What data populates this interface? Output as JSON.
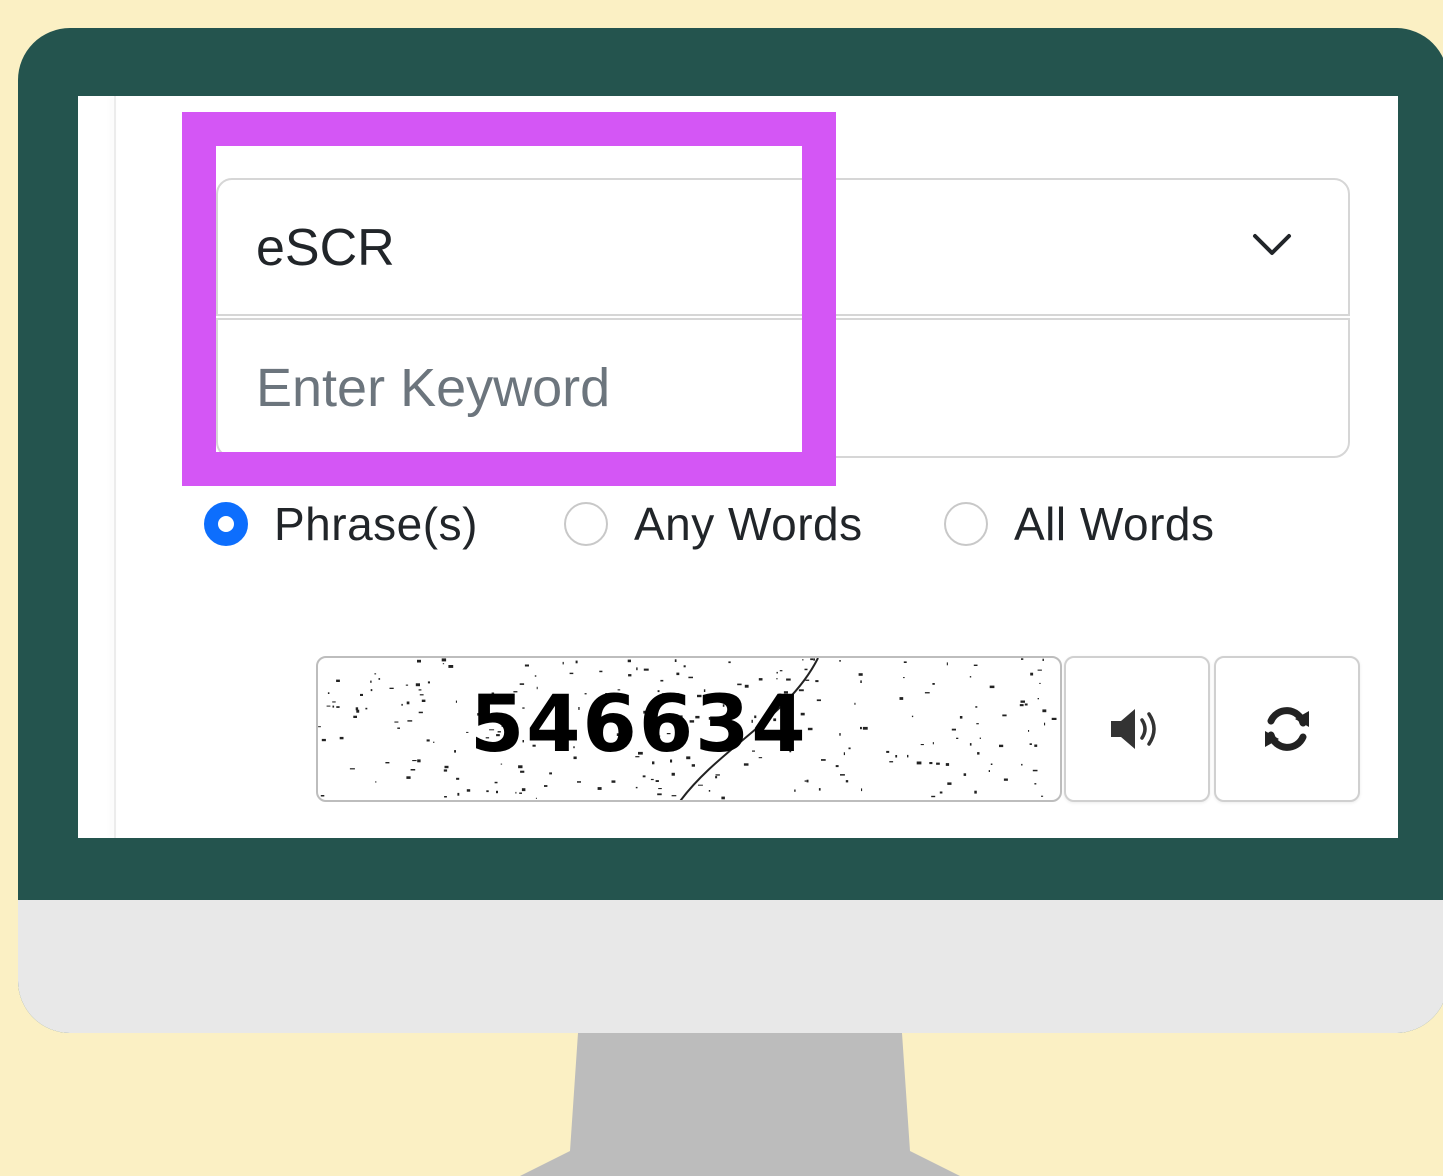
{
  "search_form": {
    "category_select": {
      "value": "eSCR"
    },
    "keyword_input": {
      "value": "",
      "placeholder": "Enter Keyword"
    },
    "match_mode": {
      "options": [
        {
          "label": "Phrase(s)",
          "checked": true
        },
        {
          "label": "Any Words",
          "checked": false
        },
        {
          "label": "All Words",
          "checked": false
        }
      ]
    },
    "captcha": {
      "code": "546634",
      "audio_icon": "speaker-icon",
      "refresh_icon": "refresh-icon"
    }
  },
  "colors": {
    "page_background": "#fbf0c4",
    "monitor_bezel": "#24544e",
    "monitor_chin": "#e8e8e8",
    "monitor_stand": "#bcbcbc",
    "highlight_border": "#d456f5",
    "radio_checked": "#0d6efd"
  }
}
